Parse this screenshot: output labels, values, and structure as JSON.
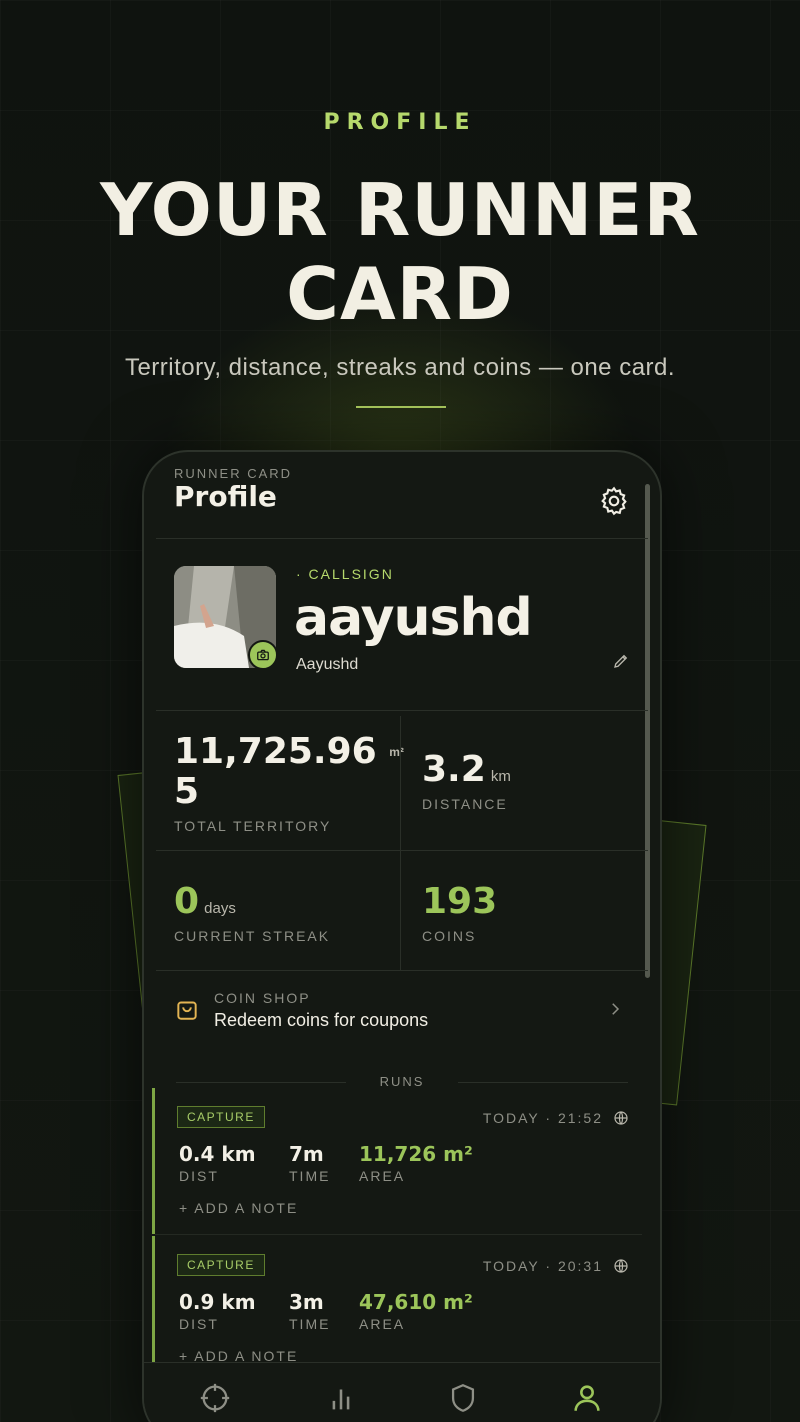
{
  "hero": {
    "eyebrow": "PROFILE",
    "headline_line1": "YOUR RUNNER",
    "headline_line2": "CARD",
    "subtitle": "Territory, distance, streaks and coins — one card."
  },
  "app": {
    "header": {
      "eyebrow": "RUNNER CARD",
      "title": "Profile",
      "settings_icon": "gear-icon"
    },
    "identity": {
      "callsign_label": "· CALLSIGN",
      "handle": "aayushd",
      "display_name": "Aayushd",
      "camera_icon": "camera-icon",
      "edit_icon": "pencil-icon"
    },
    "stats": {
      "territory": {
        "value_line1": "11,725.96",
        "value_line2": "5",
        "unit": "m²",
        "label": "TOTAL TERRITORY"
      },
      "distance": {
        "value": "3.2",
        "unit": "km",
        "label": "DISTANCE"
      },
      "streak": {
        "value": "0",
        "unit": "days",
        "label": "CURRENT STREAK"
      },
      "coins": {
        "value": "193",
        "label": "COINS"
      }
    },
    "coin_shop": {
      "label": "COIN SHOP",
      "text": "Redeem coins for coupons",
      "icon": "shopping-bag-icon"
    },
    "runs": {
      "label": "RUNS",
      "items": [
        {
          "tag": "CAPTURE",
          "when": "TODAY · 21:52",
          "dist": "0.4 km",
          "dist_label": "DIST",
          "time": "7m",
          "time_label": "TIME",
          "area": "11,726 m²",
          "area_label": "AREA",
          "note": "+ ADD A NOTE"
        },
        {
          "tag": "CAPTURE",
          "when": "TODAY · 20:31",
          "dist": "0.9 km",
          "dist_label": "DIST",
          "time": "3m",
          "time_label": "TIME",
          "area": "47,610 m²",
          "area_label": "AREA",
          "note": "+ ADD A NOTE"
        }
      ]
    },
    "bottom_nav": [
      "crosshair-icon",
      "bar-chart-icon",
      "shield-icon",
      "user-icon"
    ],
    "colors": {
      "accent": "#9cc55a",
      "accent_text": "#b6d96c",
      "background": "#141813",
      "text": "#f3f0e6",
      "muted": "#8e8f86"
    }
  }
}
